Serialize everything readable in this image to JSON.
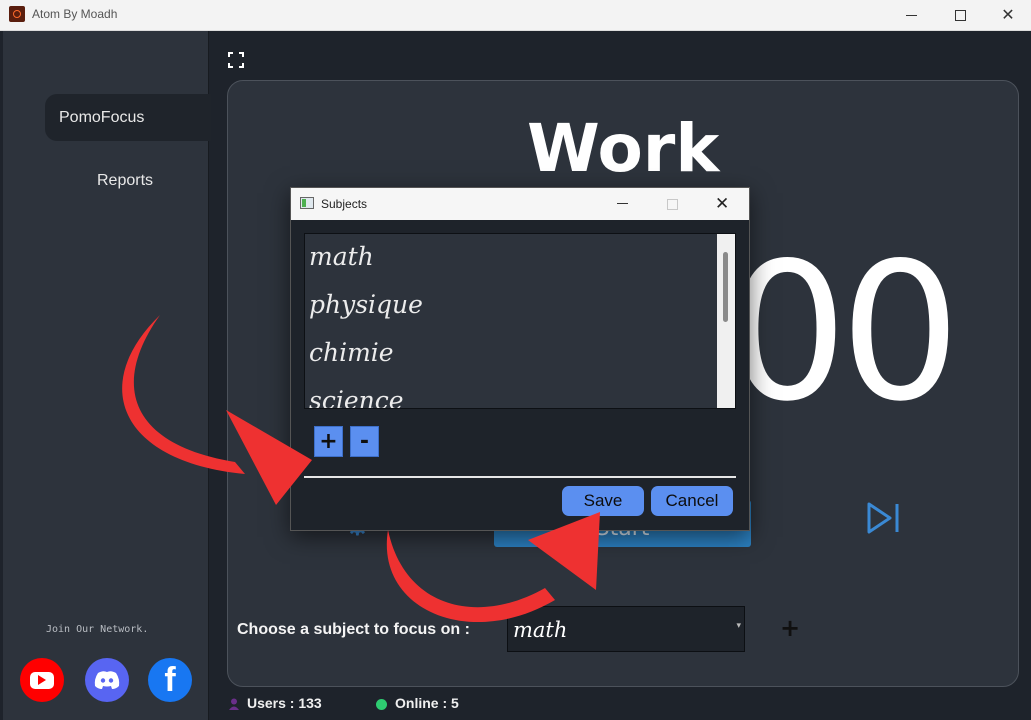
{
  "window": {
    "title": "Atom By Moadh"
  },
  "sidebar": {
    "items": [
      {
        "label": "PomoFocus"
      },
      {
        "label": "Reports"
      }
    ],
    "join_text": "Join Our Network.",
    "social_icons": [
      "youtube-icon",
      "discord-icon",
      "facebook-icon"
    ]
  },
  "main": {
    "mode_label": "Work",
    "timer_text": "00",
    "start_label": "Start",
    "choose_label": "Choose a subject to focus on :",
    "selected_subject": "math",
    "add_subject_symbol": "+"
  },
  "status_bar": {
    "users": "Users : 133",
    "online": "Online : 5"
  },
  "dialog": {
    "title": "Subjects",
    "subjects": [
      "math",
      "physique",
      "chimie",
      "science"
    ],
    "add_label": "+",
    "remove_label": "-",
    "save_label": "Save",
    "cancel_label": "Cancel"
  },
  "colors": {
    "background": "#1e232b",
    "panel": "#2d333c",
    "accent_blue": "#5b8ff0",
    "start_button": "#2b7fbf",
    "annotation_arrow": "#ee3131",
    "online": "#2ecc71"
  }
}
